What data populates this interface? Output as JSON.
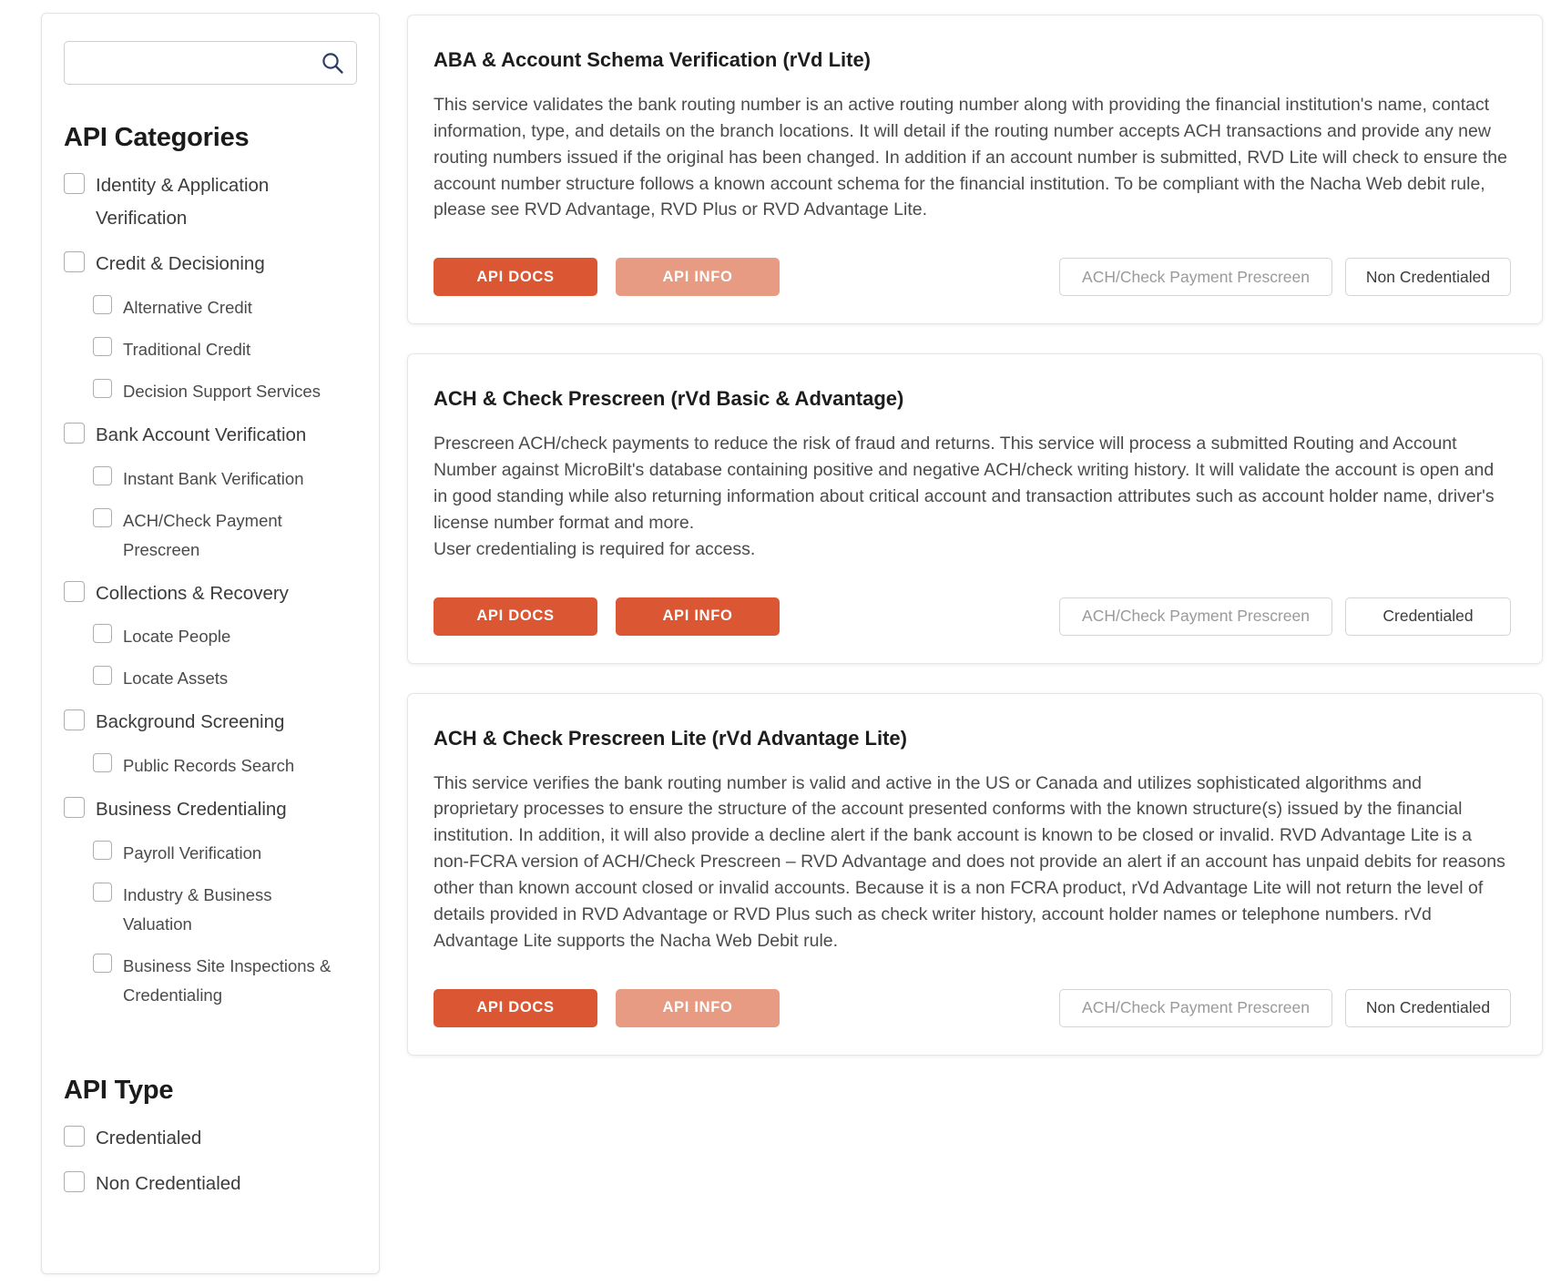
{
  "sidebar": {
    "search": {
      "value": "",
      "placeholder": "",
      "icon": "search-icon"
    },
    "categories_heading": "API Categories",
    "categories": [
      {
        "label": "Identity & Application Verification",
        "level": "top",
        "checked": false
      },
      {
        "label": "Credit & Decisioning",
        "level": "top",
        "checked": false
      },
      {
        "label": "Alternative Credit",
        "level": "sub",
        "checked": false
      },
      {
        "label": "Traditional Credit",
        "level": "sub",
        "checked": false
      },
      {
        "label": "Decision Support Services",
        "level": "sub",
        "checked": false
      },
      {
        "label": "Bank Account Verification",
        "level": "top",
        "checked": false
      },
      {
        "label": "Instant Bank Verification",
        "level": "sub",
        "checked": false
      },
      {
        "label": "ACH/Check Payment Prescreen",
        "level": "sub",
        "checked": false
      },
      {
        "label": "Collections & Recovery",
        "level": "top",
        "checked": false
      },
      {
        "label": "Locate People",
        "level": "sub",
        "checked": false
      },
      {
        "label": "Locate Assets",
        "level": "sub",
        "checked": false
      },
      {
        "label": "Background Screening",
        "level": "top",
        "checked": false
      },
      {
        "label": "Public Records Search",
        "level": "sub",
        "checked": false
      },
      {
        "label": "Business Credentialing",
        "level": "top",
        "checked": false
      },
      {
        "label": "Payroll Verification",
        "level": "sub",
        "checked": false
      },
      {
        "label": "Industry & Business Valuation",
        "level": "sub",
        "checked": false
      },
      {
        "label": "Business Site Inspections & Credentialing",
        "level": "sub",
        "checked": false
      }
    ],
    "type_heading": "API Type",
    "types": [
      {
        "label": "Credentialed",
        "level": "top",
        "checked": false
      },
      {
        "label": "Non Credentialed",
        "level": "top",
        "checked": false
      }
    ]
  },
  "cards": [
    {
      "title": "ABA & Account Schema Verification (rVd Lite)",
      "description": "This service validates the bank routing number is an active routing number along with providing the financial institution's name, contact information, type, and details on the branch locations.  It will detail if the routing number accepts ACH transactions and provide any new routing numbers issued if the original has been changed.  In addition if an account number is submitted, RVD Lite will check to ensure the account number structure follows a known account schema for the financial institution.  To be compliant with the Nacha Web debit rule, please see RVD Advantage, RVD Plus or RVD Advantage Lite.",
      "docs_label": "API DOCS",
      "info_label": "API INFO",
      "info_style": "light",
      "category_tag": "ACH/Check Payment Prescreen",
      "type_tag": "Non Credentialed"
    },
    {
      "title": "ACH & Check Prescreen (rVd Basic & Advantage)",
      "description": "Prescreen ACH/check payments to reduce the risk of fraud and returns. This service will process a submitted Routing and Account Number against MicroBilt's database containing positive and negative ACH/check writing history. It will validate the account is open and in good standing while also returning information about critical account and transaction attributes such as account holder name, driver's license number format and more.\nUser credentialing is required for access.",
      "docs_label": "API DOCS",
      "info_label": "API INFO",
      "info_style": "solid",
      "category_tag": "ACH/Check Payment Prescreen",
      "type_tag": "Credentialed"
    },
    {
      "title": "ACH & Check Prescreen Lite (rVd Advantage Lite)",
      "description": "This service verifies the bank routing number is valid and active in the US or Canada and utilizes sophisticated algorithms and proprietary processes to ensure the structure of the account presented conforms with the known structure(s) issued by the financial institution. In addition, it will also provide a decline alert if the bank account is known to be closed or invalid. RVD Advantage Lite is a non-FCRA version of ACH/Check Prescreen – RVD Advantage and does not provide an alert if an account has unpaid debits for reasons other than known account closed or invalid accounts. Because it is a non FCRA product, rVd Advantage Lite will not return the level of details provided in RVD Advantage or RVD Plus such as check writer history, account holder names or telephone numbers. rVd Advantage Lite supports the Nacha Web Debit rule.",
      "docs_label": "API DOCS",
      "info_label": "API INFO",
      "info_style": "light",
      "category_tag": "ACH/Check Payment Prescreen",
      "type_tag": "Non Credentialed"
    }
  ],
  "colors": {
    "primary_orange": "#db5733",
    "light_orange": "#e79b83",
    "border_grey": "#e6e6e6",
    "text_dark": "#1d1d1d",
    "text_body": "#4b4b4b"
  }
}
